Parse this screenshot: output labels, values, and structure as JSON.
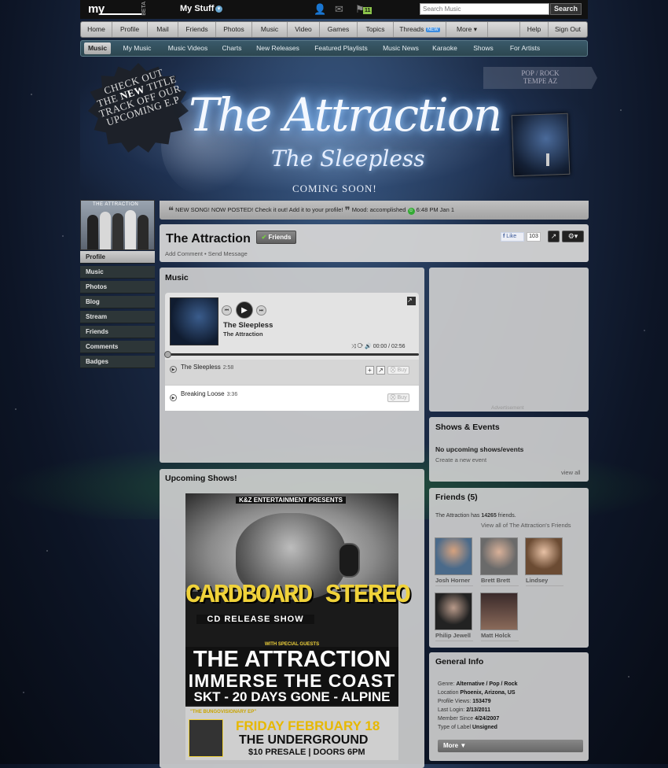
{
  "topbar": {
    "logo": "my",
    "beta": "BETA",
    "my_stuff": "My Stuff",
    "notif_count": "11",
    "search_placeholder": "Search Music",
    "search_button": "Search"
  },
  "main_nav": [
    "Home",
    "Profile",
    "Mail",
    "Friends",
    "Photos",
    "Music",
    "Video",
    "Games",
    "Topics",
    "Threads",
    "More ▾",
    "Help",
    "Sign Out"
  ],
  "threads_badge": "NEW",
  "sub_nav": [
    "Music",
    "My Music",
    "Music Videos",
    "Charts",
    "New Releases",
    "Featured Playlists",
    "Music News",
    "Karaoke",
    "Shows",
    "For Artists"
  ],
  "banner": {
    "burst_line1": "CHECK OUT",
    "burst_line2a": "THE ",
    "burst_new": "NEW",
    "burst_line2b": " TITLE",
    "burst_line3": "TRACK OFF OUR",
    "burst_line4": "UPCOMING E.P",
    "genre": "POP / ROCK",
    "location": "TEMPE AZ",
    "band": "The Attraction",
    "subtitle": "The Sleepless",
    "coming": "COMING SOON!",
    "avatar_label": "THE ATTRACTION"
  },
  "status": {
    "text": "NEW SONG! NOW POSTED! Check it out! Add it to your profile!",
    "mood_label": "Mood: accomplished",
    "time": "6:48 PM Jan 1"
  },
  "sidebar": [
    "Profile",
    "Music",
    "Photos",
    "Blog",
    "Stream",
    "Friends",
    "Comments",
    "Badges"
  ],
  "profile": {
    "name": "The Attraction",
    "friends_btn": "Friends",
    "add_comment": "Add Comment",
    "sep": "•",
    "send_message": "Send Message",
    "fb_like": "Like",
    "fb_count": "103"
  },
  "music": {
    "title": "Music",
    "now_track": "The Sleepless",
    "now_artist": "The Attraction",
    "time": "00:00 / 02:56",
    "tracks": [
      {
        "name": "The Sleepless",
        "dur": "2:58",
        "buy": "Buy"
      },
      {
        "name": "Breaking Loose",
        "dur": "3:36",
        "buy": "Buy"
      }
    ]
  },
  "upcoming": {
    "title": "Upcoming Shows!",
    "poster": {
      "entertainment": "K&Z ENTERTAINMENT PRESENTS",
      "headline": "CARDBOARD STEREO",
      "cd_release": "CD RELEASE SHOW",
      "with_special": "WITH SPECIAL GUESTS",
      "attraction": "THE ATTRACTION",
      "immerse": "IMMERSE THE COAST",
      "support": "SKT - 20 DAYS GONE - ALPINE",
      "ep": "\"THE BUNGOVISIONARY EP\"",
      "date": "FRIDAY FEBRUARY 18",
      "venue": "THE UNDERGROUND",
      "presale": "$10 PRESALE | DOORS 6PM"
    }
  },
  "ads": {
    "label": "Advertisement"
  },
  "shows": {
    "title": "Shows & Events",
    "none": "No upcoming shows/events",
    "create": "Create a new event",
    "view_all": "view all"
  },
  "friends": {
    "title": "Friends (5)",
    "summary_pre": "The Attraction has ",
    "count": "14265",
    "summary_post": " friends.",
    "view_all": "View all of The Attraction's Friends",
    "list": [
      "Josh Horner",
      "Brett Brett",
      "Lindsey",
      "Philip Jewell",
      "Matt Holck"
    ]
  },
  "general": {
    "title": "General Info",
    "rows": [
      {
        "k": "Genre: ",
        "v": "Alternative / Pop / Rock"
      },
      {
        "k": "Location ",
        "v": "Phoenix, Arizona, US"
      },
      {
        "k": "Profile Views: ",
        "v": "153479"
      },
      {
        "k": "Last Login: ",
        "v": "2/13/2011"
      },
      {
        "k": "Member Since ",
        "v": "4/24/2007"
      },
      {
        "k": "Type of Label ",
        "v": "Unsigned"
      }
    ],
    "more": "More ▼"
  },
  "colors": {
    "nav_bg": "#cccccc",
    "subnav_bg": "#33505c",
    "panel_bg": "#d2d2d2",
    "accent_new": "#3a8be0"
  }
}
